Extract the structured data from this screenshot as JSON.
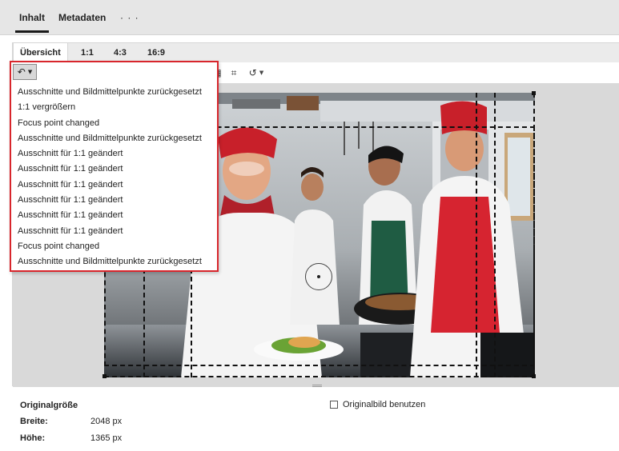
{
  "top_tabs": [
    {
      "label": "Inhalt",
      "active": true
    },
    {
      "label": "Metadaten",
      "active": false
    },
    {
      "label": "· · ·",
      "active": false
    }
  ],
  "sub_tabs": [
    {
      "label": "Übersicht",
      "active": true
    },
    {
      "label": "1:1",
      "active": false
    },
    {
      "label": "4:3",
      "active": false
    },
    {
      "label": "16:9",
      "active": false
    }
  ],
  "toolbar": {
    "icons": [
      "undo-icon",
      "redo-icon",
      "delete-icon",
      "download-icon",
      "filter-icon",
      "flip-horizontal-icon",
      "flip-vertical-icon",
      "brightness-icon",
      "crop-frame-icon",
      "crop-icon",
      "reset-icon"
    ]
  },
  "history": {
    "items": [
      "Ausschnitte und Bildmittelpunkte zurückgesetzt",
      "1:1 vergrößern",
      "Focus point changed",
      "Ausschnitte und Bildmittelpunkte zurückgesetzt",
      "Ausschnitt für 1:1 geändert",
      "Ausschnitt für 1:1 geändert",
      "Ausschnitt für 1:1 geändert",
      "Ausschnitt für 1:1 geändert",
      "Ausschnitt für 1:1 geändert",
      "Ausschnitt für 1:1 geändert",
      "Focus point changed",
      "Ausschnitte und Bildmittelpunkte zurückgesetzt"
    ]
  },
  "info": {
    "title": "Originalgröße",
    "width_label": "Breite:",
    "width_value": "2048 px",
    "height_label": "Höhe:",
    "height_value": "1365 px",
    "use_original_label": "Originalbild benutzen",
    "use_original_checked": false
  },
  "colors": {
    "highlight_border": "#d8262c",
    "chef_red": "#c8202a"
  }
}
